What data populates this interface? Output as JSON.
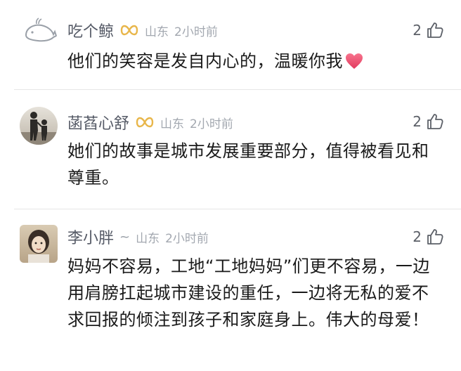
{
  "comments": [
    {
      "username": "吃个鲸",
      "location": "山东",
      "time": "2小时前",
      "likes": "2",
      "text": "他们的笑容是发自内心的，温暖你我"
    },
    {
      "username": "菡萏心舒",
      "location": "山东",
      "time": "2小时前",
      "likes": "2",
      "text": "她们的故事是城市发展重要部分，值得被看见和尊重。"
    },
    {
      "username": "李小胖",
      "location": "山东",
      "time": "2小时前",
      "likes": "2",
      "text": "妈妈不容易，工地“工地妈妈”们更不容易，一边用肩膀扛起城市建设的重任，一边将无私的爱不求回报的倾注到孩子和家庭身上。伟大的母爱！"
    }
  ],
  "colors": {
    "username": "#555a66",
    "meta": "#a3a8b0",
    "body": "#1a1a1a",
    "badge": "#e8b64a",
    "heart": "#ea4c6f"
  },
  "icons": {
    "like": "thumbs-up-icon",
    "badge": "infinity-badge-icon",
    "heart": "heart-icon"
  }
}
